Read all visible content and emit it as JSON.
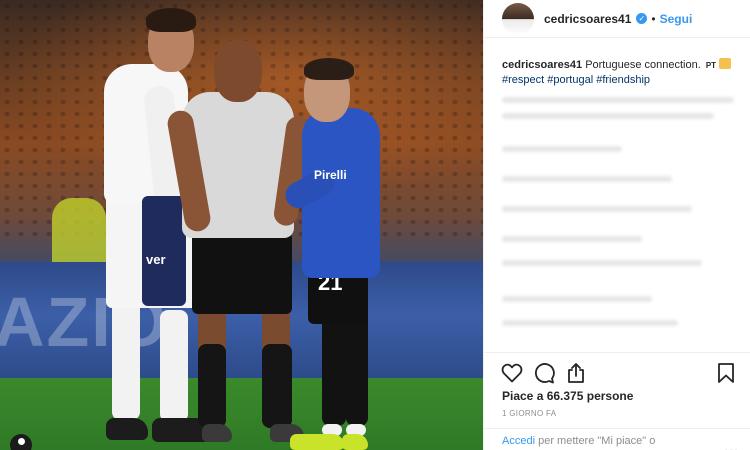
{
  "post": {
    "username": "cedricsoares41",
    "verified": true,
    "separator": "•",
    "follow_label": "Segui"
  },
  "photo": {
    "description_icon": "user-tag-icon",
    "board_text": "AZIO",
    "jersey_number": "21",
    "sponsor_text": "Pirelli"
  },
  "caption": {
    "username": "cedricsoares41",
    "text": "Portuguese connection.",
    "flag": "PT",
    "emoji": "face-emoji",
    "hashtags": [
      "#respect",
      "#portugal",
      "#friendship"
    ]
  },
  "actions": {
    "like_icon": "heart-icon",
    "comment_icon": "comment-icon",
    "share_icon": "share-icon",
    "save_icon": "bookmark-icon",
    "likes_text": "Piace a 66.375 persone",
    "time_text": "1 GIORNO FA"
  },
  "login": {
    "link": "Accedi",
    "rest": "per mettere \"Mi piace\" o",
    "more": "..."
  },
  "colors": {
    "link_blue": "#3897f0",
    "hashtag": "#003569",
    "muted": "#8e8e8e"
  }
}
